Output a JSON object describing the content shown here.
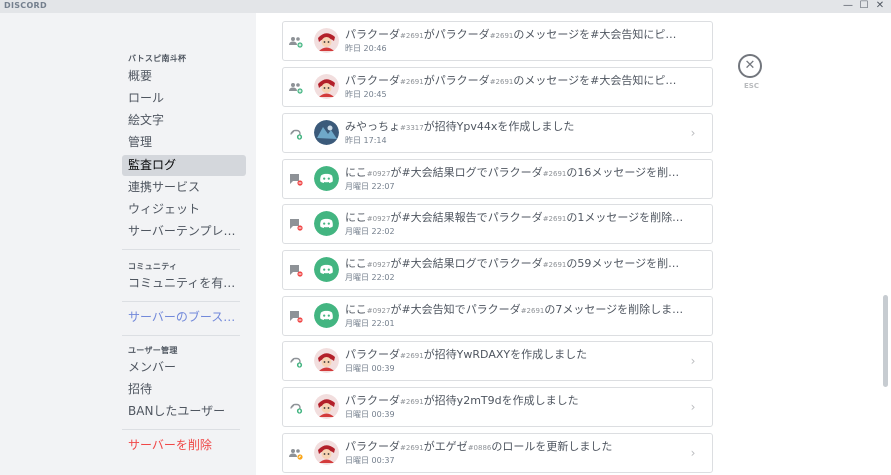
{
  "titlebar": {
    "brand": "DISCORD",
    "minimize": "—",
    "maximize": "☐",
    "close": "✕"
  },
  "sidebar": {
    "server_name": "バトスピ南斗杯",
    "items": [
      {
        "label": "概要"
      },
      {
        "label": "ロール"
      },
      {
        "label": "絵文字"
      },
      {
        "label": "管理"
      },
      {
        "label": "監査ログ"
      },
      {
        "label": "連携サービス"
      },
      {
        "label": "ウィジェット"
      },
      {
        "label": "サーバーテンプレート"
      }
    ],
    "community_header": "コミュニティ",
    "community_item": "コミュニティを有効に...",
    "boost_item": "サーバーのブースト状...",
    "user_header": "ユーザー管理",
    "user_items": [
      {
        "label": "メンバー"
      },
      {
        "label": "招待"
      },
      {
        "label": "BANしたユーザー"
      }
    ],
    "delete_item": "サーバーを削除"
  },
  "audit_log": {
    "entries": [
      {
        "icon": "pin-icon",
        "avatar": "user-avatar",
        "user": "パラクーダ",
        "user_tag": "#2691",
        "pre": "が",
        "target": "パラクーダ",
        "target_tag": "#2691",
        "post": "のメッセージを#大会告知にピン留...",
        "time": "昨日 20:46",
        "chevron": ""
      },
      {
        "icon": "pin-icon",
        "avatar": "user-avatar",
        "user": "パラクーダ",
        "user_tag": "#2691",
        "pre": "が",
        "target": "パラクーダ",
        "target_tag": "#2691",
        "post": "のメッセージを#大会告知にピン留...",
        "time": "昨日 20:45",
        "chevron": ""
      },
      {
        "icon": "invite-icon",
        "avatar": "user-avatar-blue",
        "user": "みやっちょ",
        "user_tag": "#3317",
        "pre": "が招待Ypv44xを作成しました",
        "target": "",
        "target_tag": "",
        "post": "",
        "time": "昨日 17:14",
        "chevron": "›"
      },
      {
        "icon": "message-delete-icon",
        "avatar": "discord-avatar",
        "user": "にこ",
        "user_tag": "#0927",
        "pre": "が#大会結果ログで",
        "target": "パラクーダ",
        "target_tag": "#2691",
        "post": "の16メッセージを削除し...",
        "time": "月曜日 22:07",
        "chevron": ""
      },
      {
        "icon": "message-delete-icon",
        "avatar": "discord-avatar",
        "user": "にこ",
        "user_tag": "#0927",
        "pre": "が#大会結果報告で",
        "target": "パラクーダ",
        "target_tag": "#2691",
        "post": "の1メッセージを削除し...",
        "time": "月曜日 22:02",
        "chevron": ""
      },
      {
        "icon": "message-delete-icon",
        "avatar": "discord-avatar",
        "user": "にこ",
        "user_tag": "#0927",
        "pre": "が#大会結果ログで",
        "target": "パラクーダ",
        "target_tag": "#2691",
        "post": "の59メッセージを削除し...",
        "time": "月曜日 22:02",
        "chevron": ""
      },
      {
        "icon": "message-delete-icon",
        "avatar": "discord-avatar",
        "user": "にこ",
        "user_tag": "#0927",
        "pre": "が#大会告知で",
        "target": "パラクーダ",
        "target_tag": "#2691",
        "post": "の7メッセージを削除しました",
        "time": "月曜日 22:01",
        "chevron": ""
      },
      {
        "icon": "invite-icon",
        "avatar": "user-avatar",
        "user": "パラクーダ",
        "user_tag": "#2691",
        "pre": "が招待YwRDAXYを作成しました",
        "target": "",
        "target_tag": "",
        "post": "",
        "time": "日曜日 00:39",
        "chevron": "›"
      },
      {
        "icon": "invite-icon",
        "avatar": "user-avatar",
        "user": "パラクーダ",
        "user_tag": "#2691",
        "pre": "が招待y2mT9dを作成しました",
        "target": "",
        "target_tag": "",
        "post": "",
        "time": "日曜日 00:39",
        "chevron": "›"
      },
      {
        "icon": "role-update-icon",
        "avatar": "user-avatar",
        "user": "パラクーダ",
        "user_tag": "#2691",
        "pre": "が",
        "target": "エゲゼ",
        "target_tag": "#0886",
        "post": "のロールを更新しました",
        "time": "日曜日 00:37",
        "chevron": "›"
      }
    ]
  },
  "close": {
    "icon": "close-icon",
    "glyph": "✕",
    "label": "ESC"
  },
  "colors": {
    "accent": "#7289da",
    "danger": "#f04747",
    "discord_green": "#43b581",
    "create_green": "#43b581",
    "update_yellow": "#faa61a",
    "delete_red": "#f04747"
  }
}
